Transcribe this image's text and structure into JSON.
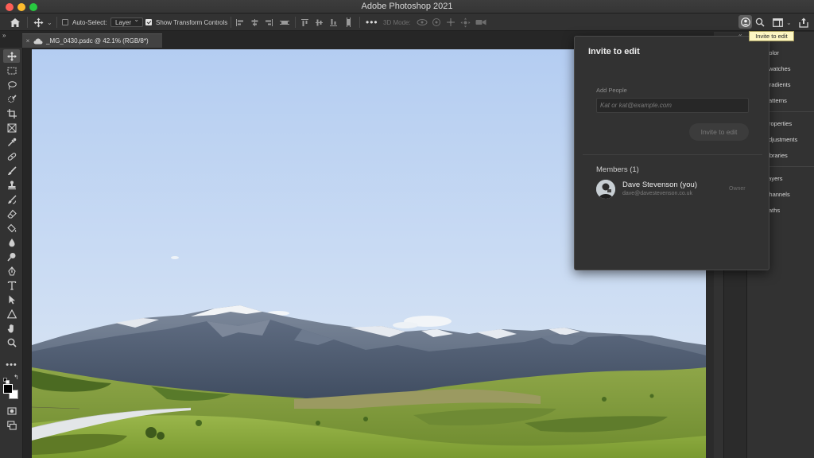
{
  "app": {
    "title": "Adobe Photoshop 2021"
  },
  "options_bar": {
    "auto_select_label": "Auto-Select:",
    "auto_select_checked": false,
    "layer_select_value": "Layer",
    "transform_controls_label": "Show Transform Controls",
    "transform_controls_checked": true,
    "three_d_mode_label": "3D Mode:"
  },
  "tooltip": {
    "text": "Invite to edit"
  },
  "document": {
    "tab_label": "_MG_0430.psdc @ 42.1% (RGB/8*)"
  },
  "invite_dialog": {
    "title": "Invite to edit",
    "add_people_label": "Add People",
    "input_value": "",
    "input_placeholder": "Kat or kat@example.com",
    "invite_button_label": "Invite to edit",
    "members_heading": "Members (1)",
    "members": [
      {
        "name": "Dave Stevenson (you)",
        "email": "dave@davestevenson.co.uk",
        "role": "Owner"
      }
    ]
  },
  "right_panels": {
    "group1": [
      {
        "label": "Color",
        "icon": "color-icon"
      },
      {
        "label": "Swatches",
        "icon": "swatches-icon"
      },
      {
        "label": "Gradients",
        "icon": "gradients-icon"
      },
      {
        "label": "Patterns",
        "icon": "patterns-icon"
      }
    ],
    "group2": [
      {
        "label": "Properties",
        "icon": "properties-icon"
      },
      {
        "label": "Adjustments",
        "icon": "adjustments-icon"
      },
      {
        "label": "Libraries",
        "icon": "libraries-icon"
      }
    ],
    "group3": [
      {
        "label": "Layers",
        "icon": "layers-icon"
      },
      {
        "label": "Channels",
        "icon": "channels-icon"
      },
      {
        "label": "Paths",
        "icon": "paths-icon"
      }
    ]
  },
  "toolbar": {
    "tools": [
      "move-tool",
      "marquee-tool",
      "lasso-tool",
      "quick-select-tool",
      "crop-tool",
      "frame-tool",
      "eyedropper-tool",
      "healing-brush-tool",
      "brush-tool",
      "clone-stamp-tool",
      "history-brush-tool",
      "eraser-tool",
      "paint-bucket-tool",
      "blur-tool",
      "dodge-tool",
      "pen-tool",
      "type-tool",
      "path-select-tool",
      "shape-tool",
      "hand-tool",
      "zoom-tool",
      "more-tools"
    ],
    "foreground_color": "#000000",
    "background_color": "#ffffff"
  },
  "colors": {
    "app_bg": "#262626",
    "panel_bg": "#323232",
    "tooltip_bg": "#fdf6c3"
  }
}
